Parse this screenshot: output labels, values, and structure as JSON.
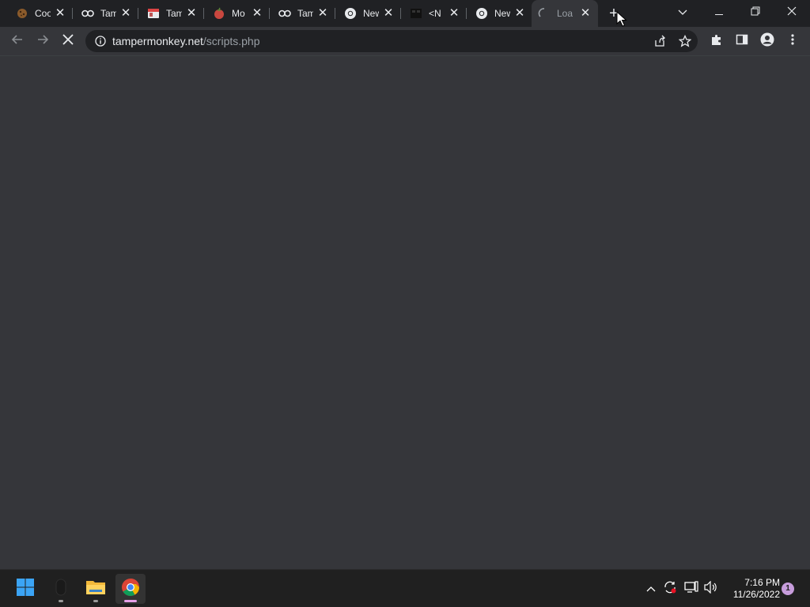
{
  "tabs": [
    {
      "title": "Coo",
      "icon": "cookie-icon"
    },
    {
      "title": "Tam",
      "icon": "tampermonkey-icon"
    },
    {
      "title": "Tam",
      "icon": "tampermonkey-store-icon"
    },
    {
      "title": "Mo",
      "icon": "tomato-icon"
    },
    {
      "title": "Tam",
      "icon": "tampermonkey-icon"
    },
    {
      "title": "New",
      "icon": "chrome-icon"
    },
    {
      "title": "<N",
      "icon": "dark-square-icon"
    },
    {
      "title": "New",
      "icon": "chrome-icon"
    },
    {
      "title": "Load",
      "icon": "loading-spinner-icon",
      "active": true
    }
  ],
  "tab_close_glyph": "✕",
  "new_tab_glyph": "+",
  "window_controls": {
    "tab_search": "chevron-down-icon",
    "minimize": "minimize-icon",
    "restore": "restore-icon",
    "close": "close-icon"
  },
  "toolbar": {
    "back": "back-arrow-icon",
    "forward": "forward-arrow-icon",
    "stop": "stop-loading-icon"
  },
  "omnibox": {
    "host": "tampermonkey.net",
    "path": "/scripts.php",
    "site_info_icon": "info-icon",
    "share_icon": "share-icon",
    "bookmark_icon": "star-icon"
  },
  "toolbar_right": {
    "extensions_icon": "puzzle-icon",
    "side_panel_icon": "side-panel-icon",
    "profile_icon": "profile-icon",
    "menu_icon": "kebab-menu-icon"
  },
  "taskbar": {
    "start_icon": "windows-start-icon",
    "apps": [
      {
        "name": "Mouse app",
        "icon": "mouse-app-icon"
      },
      {
        "name": "File Explorer",
        "icon": "folder-icon"
      },
      {
        "name": "Google Chrome",
        "icon": "chrome-icon",
        "active": true
      }
    ],
    "tray": {
      "overflow_icon": "chevron-up-icon",
      "sync_icon": "sync-icon",
      "network_icon": "network-icon",
      "volume_icon": "volume-icon"
    },
    "clock": {
      "time": "7:16 PM",
      "date": "11/26/2022"
    },
    "notification_count": "1"
  },
  "colors": {
    "tabstrip": "#202124",
    "toolbar": "#35363a",
    "omnibox": "#202124",
    "taskbar": "#202020",
    "accent_indicator": "#e6a0e8"
  }
}
